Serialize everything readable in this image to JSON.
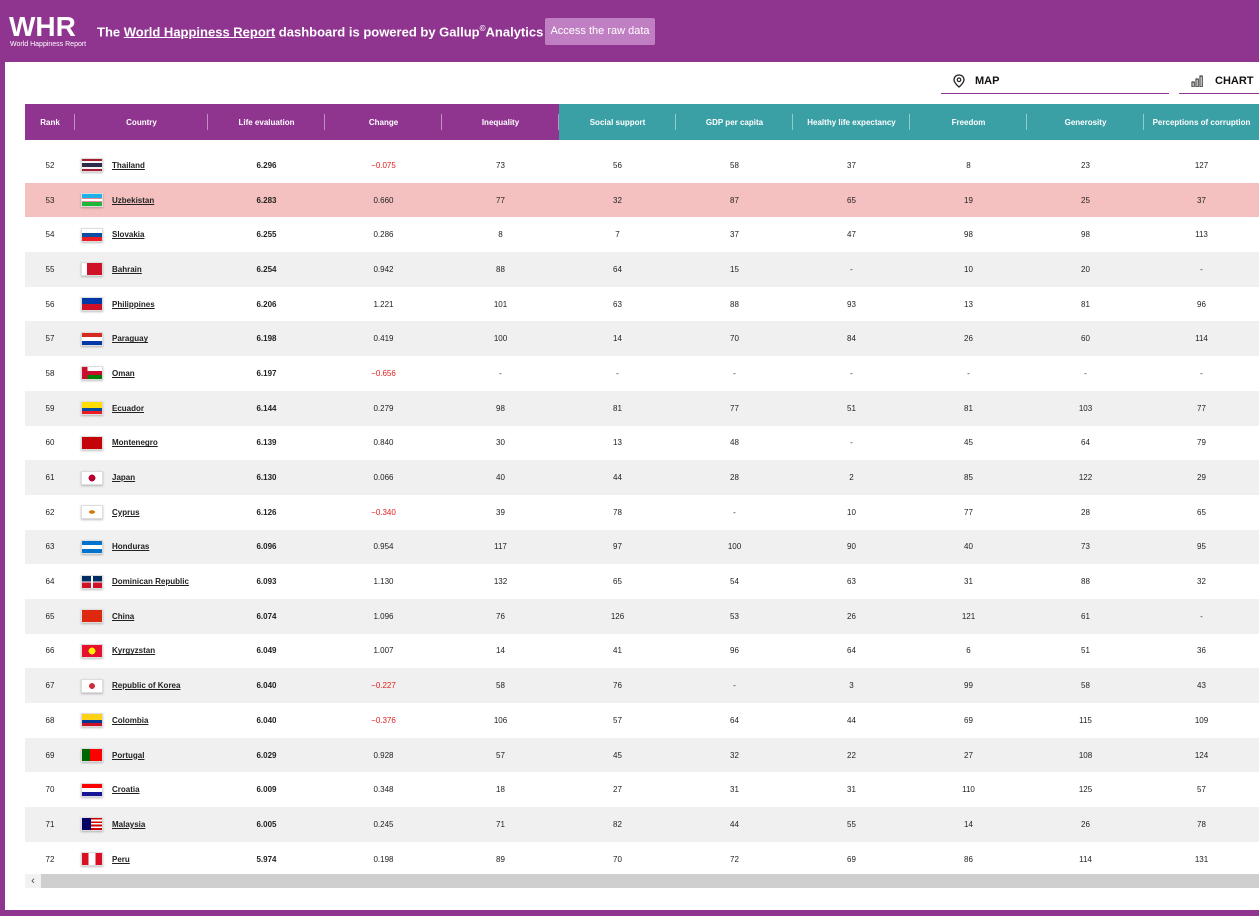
{
  "header": {
    "logo_text": "WHR",
    "logo_sub": "World Happiness Report",
    "tagline_pre": "The ",
    "tagline_link": "World Happiness Report",
    "tagline_mid": " dashboard is powered by Gallup",
    "tagline_sup": "©",
    "tagline_post": "Analytics",
    "raw_button": "Access the raw data"
  },
  "views": {
    "map_label": "MAP",
    "chart_label": "CHART"
  },
  "colors": {
    "purple": "#8f3590",
    "teal": "#3aa0a6",
    "highlight": "#f5c0c0",
    "negative": "#e02020"
  },
  "columns": [
    "Rank",
    "Country",
    "Life evaluation",
    "Change",
    "Inequality",
    "Social support",
    "GDP per capita",
    "Healthy life expectancy",
    "Freedom",
    "Generosity",
    "Perceptions of corruption"
  ],
  "rows": [
    {
      "rank": "52",
      "country": "Thailand",
      "life": "6.296",
      "change": "−0.075",
      "inequality": "73",
      "social": "56",
      "gdp": "58",
      "health": "37",
      "freedom": "8",
      "generosity": "23",
      "corruption": "127"
    },
    {
      "rank": "53",
      "country": "Uzbekistan",
      "life": "6.283",
      "change": "0.660",
      "inequality": "77",
      "social": "32",
      "gdp": "87",
      "health": "65",
      "freedom": "19",
      "generosity": "25",
      "corruption": "37"
    },
    {
      "rank": "54",
      "country": "Slovakia",
      "life": "6.255",
      "change": "0.286",
      "inequality": "8",
      "social": "7",
      "gdp": "37",
      "health": "47",
      "freedom": "98",
      "generosity": "98",
      "corruption": "113"
    },
    {
      "rank": "55",
      "country": "Bahrain",
      "life": "6.254",
      "change": "0.942",
      "inequality": "88",
      "social": "64",
      "gdp": "15",
      "health": "-",
      "freedom": "10",
      "generosity": "20",
      "corruption": "-"
    },
    {
      "rank": "56",
      "country": "Philippines",
      "life": "6.206",
      "change": "1.221",
      "inequality": "101",
      "social": "63",
      "gdp": "88",
      "health": "93",
      "freedom": "13",
      "generosity": "81",
      "corruption": "96"
    },
    {
      "rank": "57",
      "country": "Paraguay",
      "life": "6.198",
      "change": "0.419",
      "inequality": "100",
      "social": "14",
      "gdp": "70",
      "health": "84",
      "freedom": "26",
      "generosity": "60",
      "corruption": "114"
    },
    {
      "rank": "58",
      "country": "Oman",
      "life": "6.197",
      "change": "−0.656",
      "inequality": "-",
      "social": "-",
      "gdp": "-",
      "health": "-",
      "freedom": "-",
      "generosity": "-",
      "corruption": "-"
    },
    {
      "rank": "59",
      "country": "Ecuador",
      "life": "6.144",
      "change": "0.279",
      "inequality": "98",
      "social": "81",
      "gdp": "77",
      "health": "51",
      "freedom": "81",
      "generosity": "103",
      "corruption": "77"
    },
    {
      "rank": "60",
      "country": "Montenegro",
      "life": "6.139",
      "change": "0.840",
      "inequality": "30",
      "social": "13",
      "gdp": "48",
      "health": "-",
      "freedom": "45",
      "generosity": "64",
      "corruption": "79"
    },
    {
      "rank": "61",
      "country": "Japan",
      "life": "6.130",
      "change": "0.066",
      "inequality": "40",
      "social": "44",
      "gdp": "28",
      "health": "2",
      "freedom": "85",
      "generosity": "122",
      "corruption": "29"
    },
    {
      "rank": "62",
      "country": "Cyprus",
      "life": "6.126",
      "change": "−0.340",
      "inequality": "39",
      "social": "78",
      "gdp": "-",
      "health": "10",
      "freedom": "77",
      "generosity": "28",
      "corruption": "65"
    },
    {
      "rank": "63",
      "country": "Honduras",
      "life": "6.096",
      "change": "0.954",
      "inequality": "117",
      "social": "97",
      "gdp": "100",
      "health": "90",
      "freedom": "40",
      "generosity": "73",
      "corruption": "95"
    },
    {
      "rank": "64",
      "country": "Dominican Republic",
      "life": "6.093",
      "change": "1.130",
      "inequality": "132",
      "social": "65",
      "gdp": "54",
      "health": "63",
      "freedom": "31",
      "generosity": "88",
      "corruption": "32"
    },
    {
      "rank": "65",
      "country": "China",
      "life": "6.074",
      "change": "1.096",
      "inequality": "76",
      "social": "126",
      "gdp": "53",
      "health": "26",
      "freedom": "121",
      "generosity": "61",
      "corruption": "-"
    },
    {
      "rank": "66",
      "country": "Kyrgyzstan",
      "life": "6.049",
      "change": "1.007",
      "inequality": "14",
      "social": "41",
      "gdp": "96",
      "health": "64",
      "freedom": "6",
      "generosity": "51",
      "corruption": "36"
    },
    {
      "rank": "67",
      "country": "Republic of Korea",
      "life": "6.040",
      "change": "−0.227",
      "inequality": "58",
      "social": "76",
      "gdp": "-",
      "health": "3",
      "freedom": "99",
      "generosity": "58",
      "corruption": "43"
    },
    {
      "rank": "68",
      "country": "Colombia",
      "life": "6.040",
      "change": "−0.376",
      "inequality": "106",
      "social": "57",
      "gdp": "64",
      "health": "44",
      "freedom": "69",
      "generosity": "115",
      "corruption": "109"
    },
    {
      "rank": "69",
      "country": "Portugal",
      "life": "6.029",
      "change": "0.928",
      "inequality": "57",
      "social": "45",
      "gdp": "32",
      "health": "22",
      "freedom": "27",
      "generosity": "108",
      "corruption": "124"
    },
    {
      "rank": "70",
      "country": "Croatia",
      "life": "6.009",
      "change": "0.348",
      "inequality": "18",
      "social": "27",
      "gdp": "31",
      "health": "31",
      "freedom": "110",
      "generosity": "125",
      "corruption": "57"
    },
    {
      "rank": "71",
      "country": "Malaysia",
      "life": "6.005",
      "change": "0.245",
      "inequality": "71",
      "social": "82",
      "gdp": "44",
      "health": "55",
      "freedom": "14",
      "generosity": "26",
      "corruption": "78"
    },
    {
      "rank": "72",
      "country": "Peru",
      "life": "5.974",
      "change": "0.198",
      "inequality": "89",
      "social": "70",
      "gdp": "72",
      "health": "69",
      "freedom": "86",
      "generosity": "114",
      "corruption": "131"
    }
  ],
  "flags": {
    "Thailand": "linear-gradient(#a51931 0 17%, #f4f5f8 17% 33%, #2d2a4a 33% 67%, #f4f5f8 67% 83%, #a51931 83%)",
    "Uzbekistan": "linear-gradient(#1eb1e7 0 32%, #ce1126 32% 36%, #fff 36% 64%, #ce1126 64% 68%, #1eb53a 68%)",
    "Slovakia": "linear-gradient(#fff 0 33%, #0b4ea2 33% 67%, #ee1c25 67%)",
    "Bahrain": "linear-gradient(90deg, #fff 0 25%, #ce1126 25%)",
    "Philippines": "linear-gradient(#0038a8 0 50%, #ce1126 50%)",
    "Paraguay": "linear-gradient(#d52b1e 0 33%, #fff 33% 67%, #0038a8 67%)",
    "Oman": "linear-gradient(90deg, #c8102e 0 28%, transparent 28%), linear-gradient(#fff 0 33%, #c8102e 33% 67%, #008000 67%)",
    "Ecuador": "linear-gradient(#ffdd00 0 50%, #034ea2 50% 75%, #ed1c24 75%)",
    "Montenegro": "linear-gradient(#c40308, #c40308)",
    "Japan": "radial-gradient(circle at center, #bc002d 0 28%, #fff 30%)",
    "Cyprus": "radial-gradient(ellipse at center, #d57800 0 20%, #fff 22%)",
    "Honduras": "linear-gradient(#0073cf 0 33%, #fff 33% 67%, #0073cf 67%)",
    "Dominican Republic": "linear-gradient(90deg, transparent 0 44%, #fff 44% 56%, transparent 56%), linear-gradient(#002d62 0 44%, #fff 44% 56%, #ce1126 56%)",
    "China": "linear-gradient(#de2910, #de2910)",
    "Kyrgyzstan": "radial-gradient(circle at center, #ffef00 0 28%, #e8112d 30%)",
    "Republic of Korea": "radial-gradient(circle at center, #cd2e3a 0 24%, #fff 26%)",
    "Colombia": "linear-gradient(#fcd116 0 50%, #003893 50% 75%, #ce1126 75%)",
    "Portugal": "linear-gradient(90deg, #006600 0 40%, #ff0000 40%)",
    "Croatia": "linear-gradient(#ff0000 0 33%, #fff 33% 67%, #171796 67%)",
    "Malaysia": "linear-gradient(90deg, #010066 0 45%, transparent 45%), repeating-linear-gradient(#cc0001 0 14%, #fff 14% 28%)",
    "Peru": "linear-gradient(90deg, #d91023 0 33%, #fff 33% 67%, #d91023 67%)"
  }
}
